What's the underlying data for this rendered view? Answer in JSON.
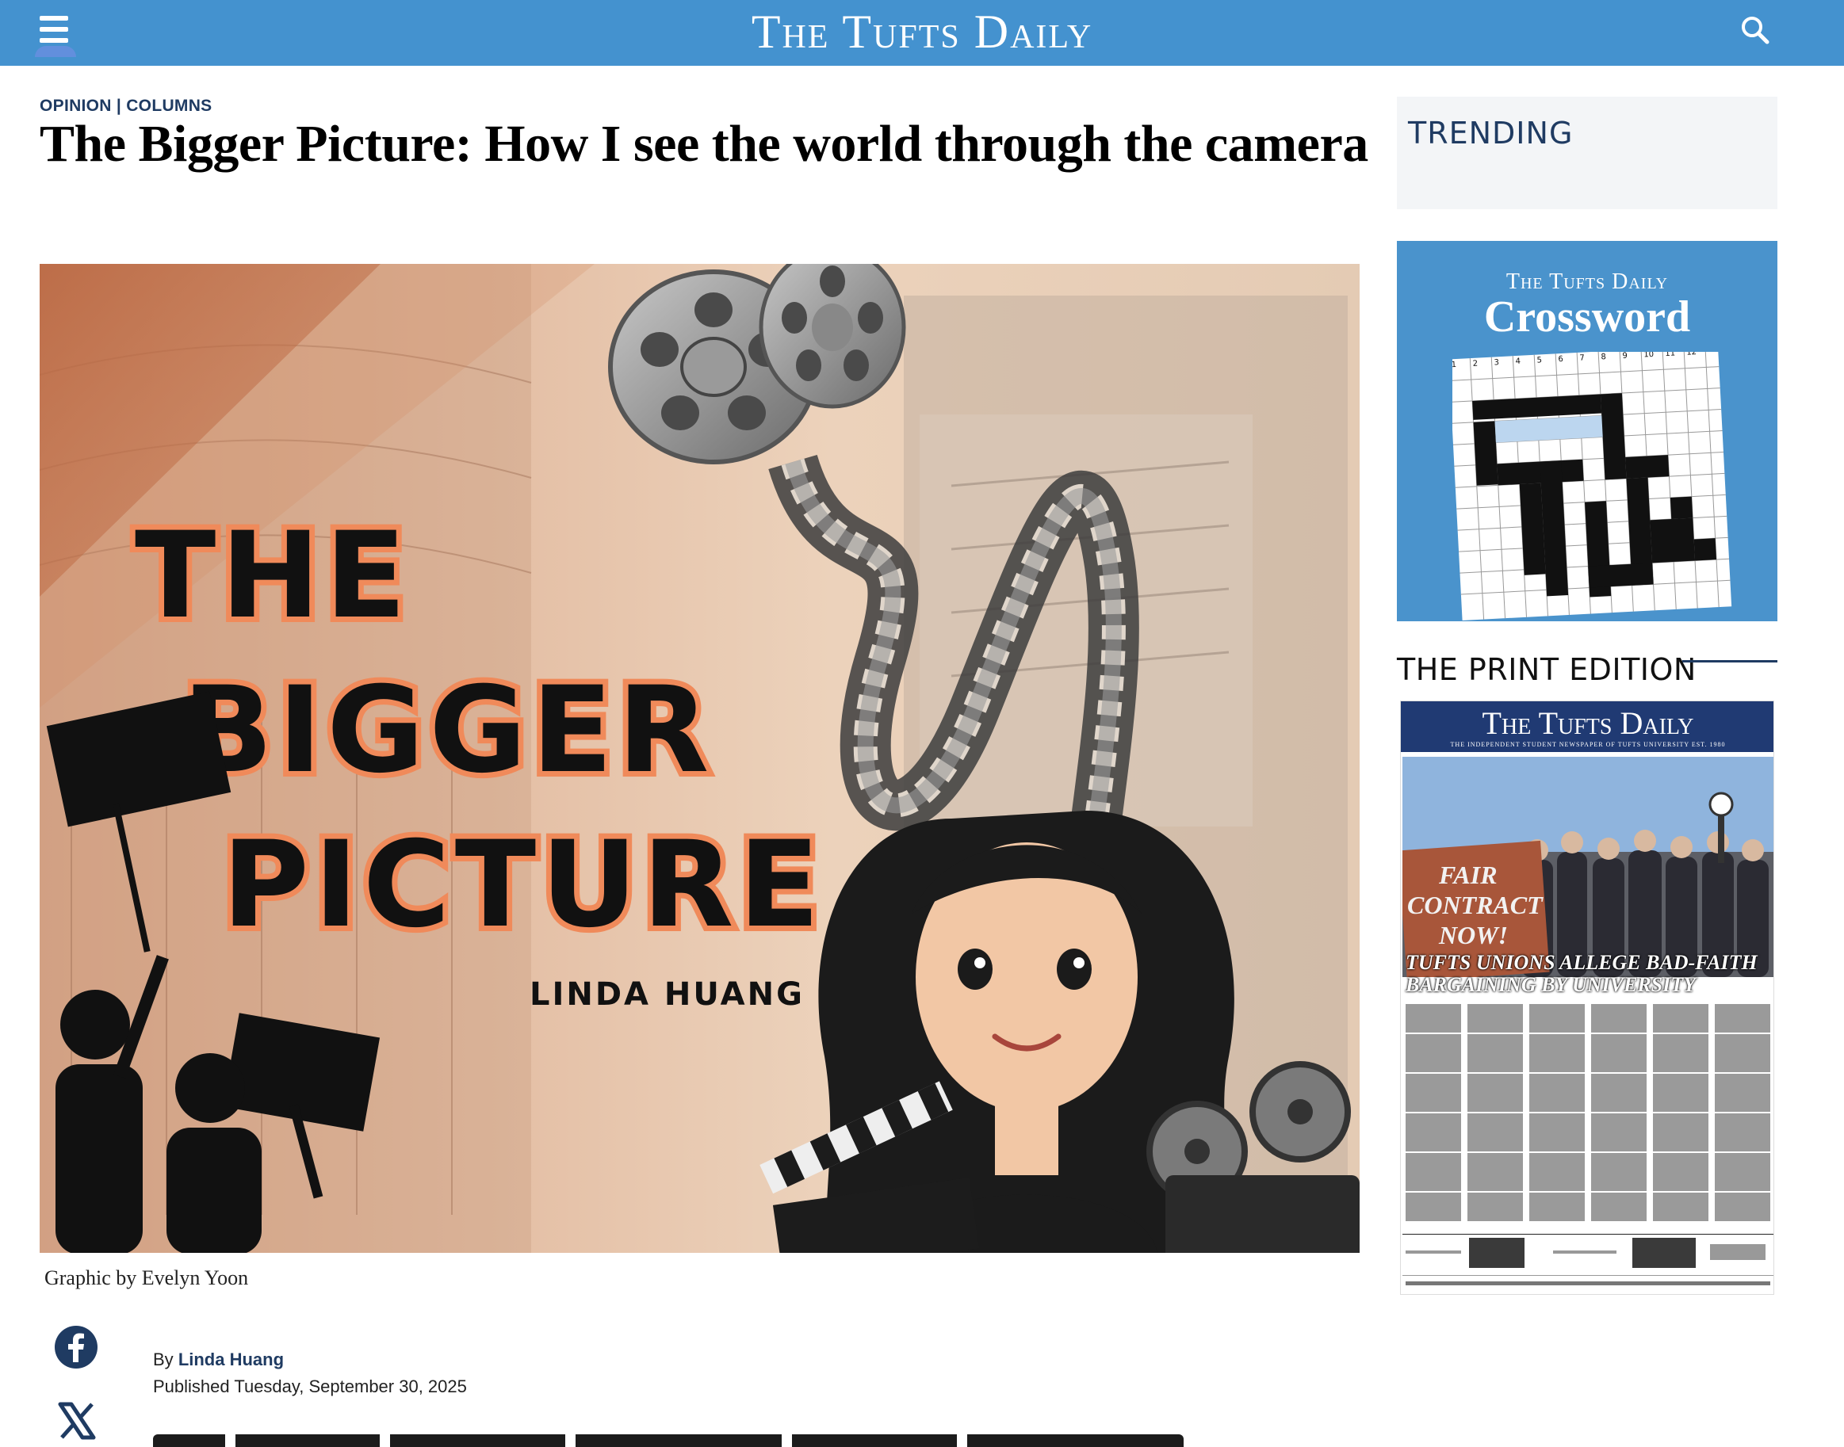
{
  "header": {
    "masthead": "The Tufts Daily",
    "menu_icon": "hamburger-menu-icon",
    "search_icon": "search-icon",
    "bar_color": "#4492cf"
  },
  "article": {
    "section": "OPINION | COLUMNS",
    "headline": "The Bigger Picture: How I see the world through the camera",
    "hero": {
      "title_lines": [
        "THE",
        "BIGGER",
        "PICTURE"
      ],
      "author_name": "LINDA HUANG"
    },
    "caption": "Graphic by Evelyn Yoon",
    "byline_prefix": "By",
    "author": "Linda Huang",
    "published": "Published Tuesday, September 30, 2025",
    "share": {
      "facebook_icon": "facebook-icon",
      "x_icon": "x-twitter-icon"
    }
  },
  "sidebar": {
    "trending_title": "TRENDING",
    "crossword": {
      "brand": "The Tufts Daily",
      "title": "Crossword",
      "top_numbers": [
        "1",
        "2",
        "3",
        "4",
        "5",
        "6",
        "7",
        "8",
        "9",
        "10",
        "11",
        "12"
      ]
    },
    "print_title": "THE PRINT EDITION",
    "print_edition": {
      "masthead": "The Tufts Daily",
      "subtitle": "THE INDEPENDENT STUDENT NEWSPAPER OF TUFTS UNIVERSITY EST. 1980",
      "banner_text": [
        "FAIR",
        "CONTRACT",
        "NOW!"
      ],
      "headline": "TUFTS UNIONS ALLEGE BAD-FAITH BARGAINING BY UNIVERSITY"
    }
  },
  "colors": {
    "accent_navy": "#1f3b62",
    "crossword_blue": "#4a93cc",
    "hero_orange": "#f08a5a"
  }
}
